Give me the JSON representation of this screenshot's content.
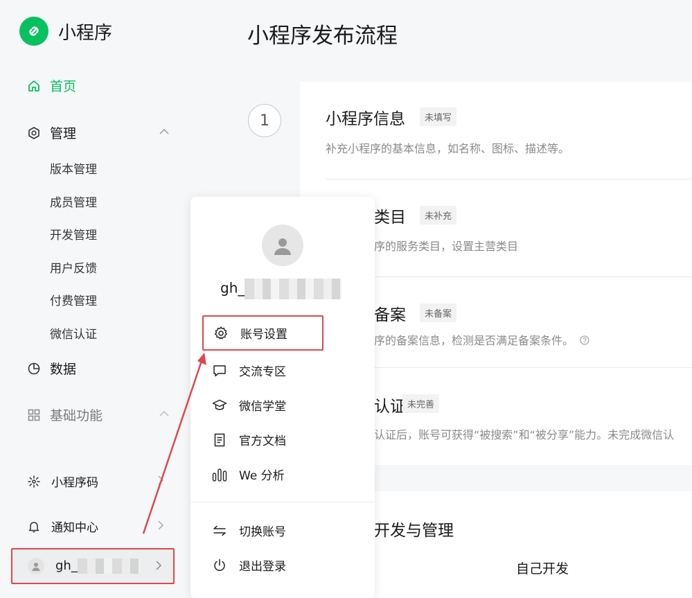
{
  "app": {
    "name": "小程序",
    "brand_color": "#07c160",
    "logo_icon": "link-icon"
  },
  "sidebar": {
    "home": {
      "label": "首页",
      "icon": "home-icon"
    },
    "manage": {
      "label": "管理",
      "icon": "hexagon-gear-icon",
      "children": [
        "版本管理",
        "成员管理",
        "开发管理",
        "用户反馈",
        "付费管理",
        "微信认证"
      ]
    },
    "data": {
      "label": "数据",
      "icon": "pie-chart-icon"
    },
    "basic": {
      "label": "基础功能",
      "icon": "grid-icon"
    },
    "bottom": [
      {
        "label": "小程序码",
        "icon": "qrcode-spark-icon"
      },
      {
        "label": "通知中心",
        "icon": "bell-icon"
      }
    ],
    "account": {
      "name": "gh_"
    }
  },
  "main": {
    "title": "小程序发布流程",
    "step_number": "1",
    "sections": [
      {
        "title": "小程序信息",
        "badge": "未填写",
        "desc": "补充小程序的基本信息，如名称、图标、描述等。"
      },
      {
        "title": "类目",
        "badge": "未补充",
        "desc": "序的服务类目，设置主营类目"
      },
      {
        "title": "备案",
        "badge": "未备案",
        "desc": "序的备案信息，检测是否满足备案条件。"
      },
      {
        "title": "认证",
        "badge": "未完善",
        "desc": "认证后，账号可获得“被搜索”和“被分享”能力。未完成微信认"
      }
    ],
    "dev_section": {
      "title": "开发与管理",
      "option": "自己开发"
    }
  },
  "popup": {
    "account_name": "gh_",
    "menu": [
      {
        "label": "账号设置",
        "icon": "gear-icon"
      },
      {
        "label": "交流专区",
        "icon": "chat-bubble-icon"
      },
      {
        "label": "微信学堂",
        "icon": "graduation-cap-icon"
      },
      {
        "label": "官方文档",
        "icon": "document-icon"
      },
      {
        "label": "We 分析",
        "icon": "analysis-bars-icon"
      }
    ],
    "footer_menu": [
      {
        "label": "切换账号",
        "icon": "switch-arrows-icon"
      },
      {
        "label": "退出登录",
        "icon": "power-icon"
      }
    ]
  },
  "colors": {
    "highlight": "#e0474c",
    "accent": "#07c160"
  }
}
